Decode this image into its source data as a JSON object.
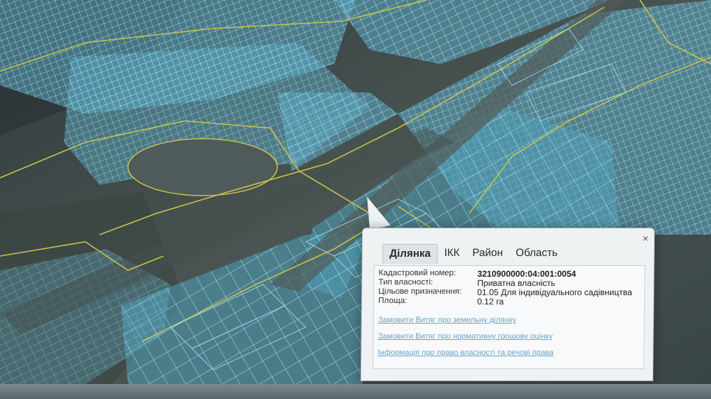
{
  "popup": {
    "close_symbol": "×",
    "tabs": [
      {
        "label": "Ділянка",
        "active": true
      },
      {
        "label": "ІКК",
        "active": false
      },
      {
        "label": "Район",
        "active": false
      },
      {
        "label": "Область",
        "active": false
      }
    ],
    "fields": {
      "cadastral_label": "Кадастровий номер:",
      "cadastral_value": "3210900000:04:001:0054",
      "ownership_label": "Тип власності:",
      "ownership_value": "Приватна власність",
      "purpose_label": "Цільове призначення:",
      "purpose_value": "01.05 Для індивідуального садівництва",
      "area_label": "Площа:",
      "area_value": "0.12 га"
    },
    "links": [
      "Замовити Витяг про земельну ділянку",
      "Замовити Витяг про нормативну грошову оцінку",
      "Інформація про право власності та речові права"
    ]
  },
  "colors": {
    "parcel_fill": "#5fb7d6",
    "parcel_stroke": "#9fe6f5",
    "boundary_line": "#c8c24a",
    "link": "#6aa3c9"
  }
}
